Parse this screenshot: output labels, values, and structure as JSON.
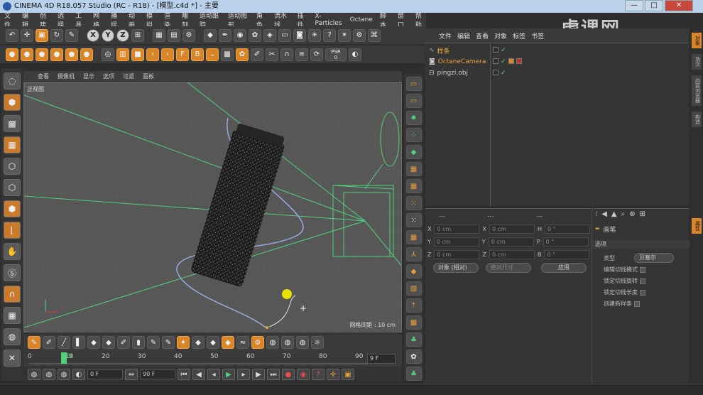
{
  "window": {
    "title": "CINEMA 4D R18.057 Studio (RC - R18) - [模型.c4d *] - 主要",
    "min": "—",
    "max": "□",
    "close": "✕"
  },
  "watermark": "虎课网",
  "menu": [
    "文件",
    "编辑",
    "创建",
    "选择",
    "工具",
    "网格",
    "捕捉",
    "动画",
    "模拟",
    "渲染",
    "雕刻",
    "运动跟踪",
    "运动图形",
    "角色",
    "流水线",
    "插件",
    "X-Particles",
    "Octane",
    "脚本",
    "窗口",
    "帮助"
  ],
  "toolbar1": {
    "axis_x": "X",
    "axis_y": "Y",
    "axis_z": "Z"
  },
  "toolbar2": {
    "psr_label": "PSR",
    "psr_value": "0",
    "letter_f": "F",
    "letter_b": "B"
  },
  "viewport": {
    "menu": [
      "查看",
      "摄像机",
      "显示",
      "选项",
      "过滤",
      "面板"
    ],
    "label": "正视图",
    "grid_text": "网格间距 : 10 cm"
  },
  "timeline": {
    "ticks": [
      "0",
      "10",
      "20",
      "30",
      "40",
      "50",
      "60",
      "70",
      "80",
      "90"
    ],
    "current": "9",
    "frame_field": "9 F"
  },
  "transport": {
    "start_field": "0 F",
    "end_field": "90 F"
  },
  "object_manager": {
    "menu": [
      "文件",
      "编辑",
      "查看",
      "对象",
      "标签",
      "书签"
    ],
    "objects": [
      {
        "name": "样条",
        "selected": true
      },
      {
        "name": "OctaneCamera",
        "selected": true
      },
      {
        "name": "pingzi.obj",
        "selected": false
      }
    ]
  },
  "coords": {
    "header": [
      "---",
      "---",
      "---"
    ],
    "rows": [
      {
        "a": "X",
        "av": "0 cm",
        "b": "X",
        "bv": "0 cm",
        "c": "H",
        "cv": "0 °"
      },
      {
        "a": "Y",
        "av": "0 cm",
        "b": "Y",
        "bv": "0 cm",
        "c": "P",
        "cv": "0 °"
      },
      {
        "a": "Z",
        "av": "0 cm",
        "b": "Z",
        "bv": "0 cm",
        "c": "B",
        "cv": "0 °"
      }
    ],
    "mode_dropdown": "对象 (相对)",
    "size_dropdown": "绝对尺寸",
    "apply_button": "应用"
  },
  "attributes": {
    "title": "画笔",
    "section": "选项",
    "type_label": "类型",
    "type_value": "贝塞尔",
    "options": [
      "编辑切线模式",
      "锁定切线旋转",
      "锁定切线长度",
      "创建新样条"
    ]
  },
  "side_tabs": [
    "对象",
    "场次",
    "内容浏览器",
    "构造"
  ],
  "attr_tab": "属性",
  "colors": {
    "accent": "#d9862a",
    "camera_green": "#4fd07a",
    "spline_blue": "#9aa8e0"
  }
}
